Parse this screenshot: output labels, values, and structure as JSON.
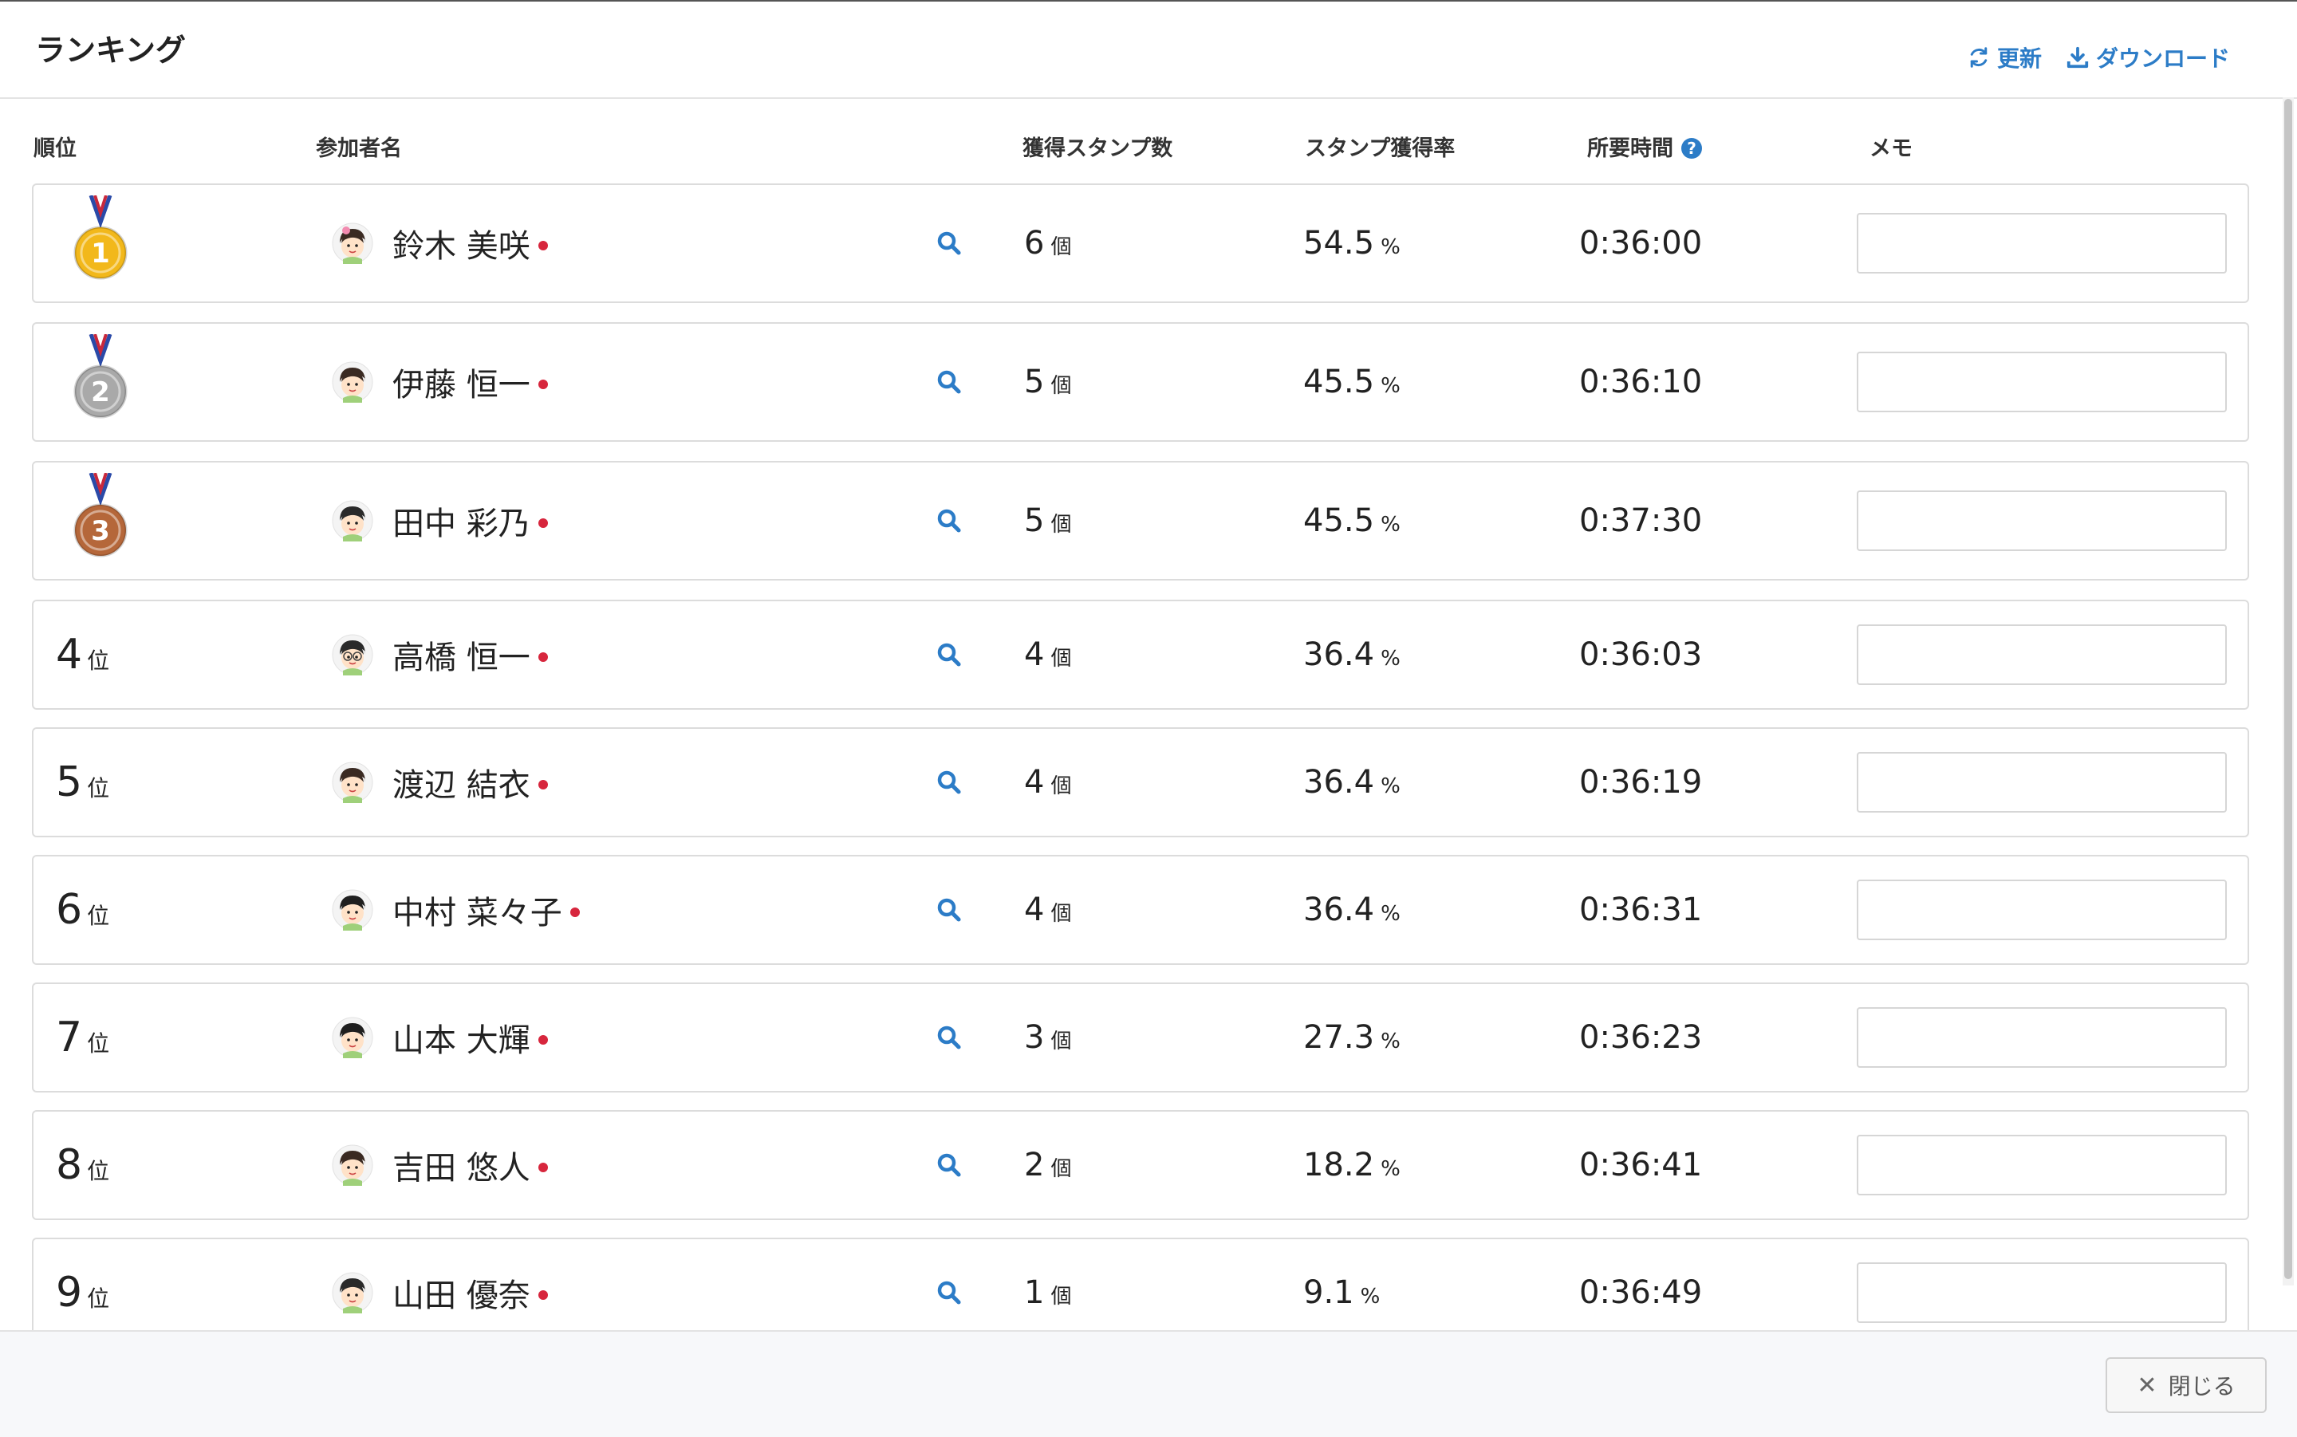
{
  "dialog": {
    "title": "ランキング",
    "refresh_label": "更新",
    "download_label": "ダウンロード",
    "close_label": "閉じる"
  },
  "columns": {
    "rank": "順位",
    "participant": "参加者名",
    "stamps": "獲得スタンプ数",
    "rate": "スタンプ獲得率",
    "time": "所要時間",
    "memo": "メモ"
  },
  "colors": {
    "accent": "#2c7cc7",
    "online_dot": "#d7263d",
    "gold": "#f2b81b",
    "silver": "#a9a9a9",
    "bronze": "#b5673a"
  },
  "rows": [
    {
      "rank": "1",
      "medal": "gold",
      "rank_suffix": "位",
      "name": "鈴木 美咲",
      "stamps": "6",
      "stamp_unit": "個",
      "rate": "54.5",
      "rate_unit": "%",
      "time": "0:36:00",
      "memo": ""
    },
    {
      "rank": "2",
      "medal": "silver",
      "rank_suffix": "位",
      "name": "伊藤 恒一",
      "stamps": "5",
      "stamp_unit": "個",
      "rate": "45.5",
      "rate_unit": "%",
      "time": "0:36:10",
      "memo": ""
    },
    {
      "rank": "3",
      "medal": "bronze",
      "rank_suffix": "位",
      "name": "田中 彩乃",
      "stamps": "5",
      "stamp_unit": "個",
      "rate": "45.5",
      "rate_unit": "%",
      "time": "0:37:30",
      "memo": ""
    },
    {
      "rank": "4",
      "medal": null,
      "rank_suffix": "位",
      "name": "高橋 恒一",
      "stamps": "4",
      "stamp_unit": "個",
      "rate": "36.4",
      "rate_unit": "%",
      "time": "0:36:03",
      "memo": ""
    },
    {
      "rank": "5",
      "medal": null,
      "rank_suffix": "位",
      "name": "渡辺 結衣",
      "stamps": "4",
      "stamp_unit": "個",
      "rate": "36.4",
      "rate_unit": "%",
      "time": "0:36:19",
      "memo": ""
    },
    {
      "rank": "6",
      "medal": null,
      "rank_suffix": "位",
      "name": "中村 菜々子",
      "stamps": "4",
      "stamp_unit": "個",
      "rate": "36.4",
      "rate_unit": "%",
      "time": "0:36:31",
      "memo": ""
    },
    {
      "rank": "7",
      "medal": null,
      "rank_suffix": "位",
      "name": "山本 大輝",
      "stamps": "3",
      "stamp_unit": "個",
      "rate": "27.3",
      "rate_unit": "%",
      "time": "0:36:23",
      "memo": ""
    },
    {
      "rank": "8",
      "medal": null,
      "rank_suffix": "位",
      "name": "吉田 悠人",
      "stamps": "2",
      "stamp_unit": "個",
      "rate": "18.2",
      "rate_unit": "%",
      "time": "0:36:41",
      "memo": ""
    },
    {
      "rank": "9",
      "medal": null,
      "rank_suffix": "位",
      "name": "山田 優奈",
      "stamps": "1",
      "stamp_unit": "個",
      "rate": "9.1",
      "rate_unit": "%",
      "time": "0:36:49",
      "memo": ""
    }
  ]
}
